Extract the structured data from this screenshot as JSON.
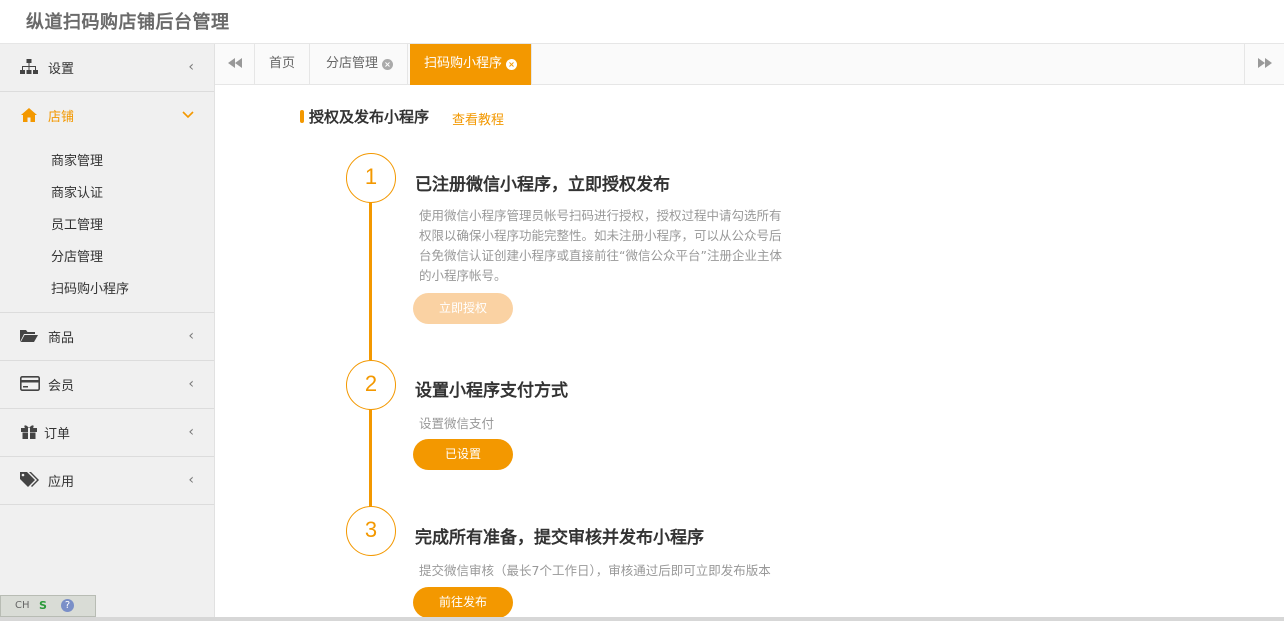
{
  "app": {
    "title": "纵道扫码购店铺后台管理"
  },
  "sidebar": {
    "items": [
      {
        "label": "设置",
        "icon": "sitemap-icon",
        "chevron": "‹"
      },
      {
        "label": "店铺",
        "icon": "home-icon",
        "chevron": "⌄",
        "active": true,
        "children": [
          "商家管理",
          "商家认证",
          "员工管理",
          "分店管理",
          "扫码购小程序"
        ]
      },
      {
        "label": "商品",
        "icon": "folder-open-icon",
        "chevron": "‹"
      },
      {
        "label": "会员",
        "icon": "credit-card-icon",
        "chevron": "‹"
      },
      {
        "label": "订单",
        "icon": "gift-icon",
        "chevron": "‹"
      },
      {
        "label": "应用",
        "icon": "tags-icon",
        "chevron": "‹"
      }
    ]
  },
  "tabs": {
    "prev": "◀◀",
    "next": "▶▶",
    "items": [
      {
        "label": "首页",
        "closable": false
      },
      {
        "label": "分店管理",
        "closable": true
      },
      {
        "label": "扫码购小程序",
        "closable": true,
        "active": true
      }
    ],
    "close_glyph": "×"
  },
  "content": {
    "section_title": "授权及发布小程序",
    "tutorial_link": "查看教程",
    "steps": [
      {
        "number": "1",
        "title": "已注册微信小程序，立即授权发布",
        "desc": [
          "使用微信小程序管理员帐号扫码进行授权，授权过程中请勾选所有",
          "权限以确保小程序功能完整性。如未注册小程序，可以从公众号后",
          "台免微信认证创建小程序或直接前往“微信公众平台”注册企业主体",
          "的小程序帐号。"
        ],
        "button": "立即授权",
        "button_state": "disabled"
      },
      {
        "number": "2",
        "title": "设置小程序支付方式",
        "desc": [
          "设置微信支付"
        ],
        "button": "已设置",
        "button_state": "enabled"
      },
      {
        "number": "3",
        "title": "完成所有准备，提交审核并发布小程序",
        "desc": [
          "提交微信审核（最长7个工作日），审核通过后即可立即发布版本"
        ],
        "button": "前往发布",
        "button_state": "enabled"
      }
    ]
  },
  "ime": {
    "lang": "CH",
    "s": "S",
    "help": "?"
  },
  "colors": {
    "accent": "#f39800",
    "accent_light": "#fad2a3",
    "sidebar_bg": "#f0f0f0"
  }
}
